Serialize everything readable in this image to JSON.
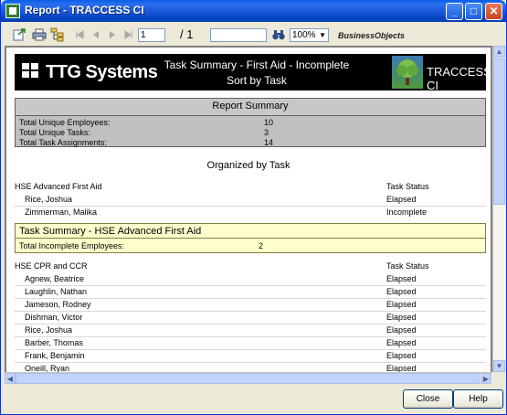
{
  "window": {
    "title": "Report - TRACCESS CI",
    "min_label": "_",
    "max_label": "□",
    "close_label": "✕"
  },
  "toolbar": {
    "page_value": "1",
    "page_total": "/ 1",
    "search_value": "",
    "zoom": "100%",
    "brand": "BusinessObjects"
  },
  "banner": {
    "logo": "TTG Systems",
    "title_line1": "Task Summary - First Aid - Incomplete",
    "title_line2": "Sort by Task",
    "product": "TRACCESS CI"
  },
  "summary": {
    "header": "Report Summary",
    "rows": [
      {
        "label": "Total Unique Employees:",
        "value": "10"
      },
      {
        "label": "Total Unique Tasks:",
        "value": "3"
      },
      {
        "label": "Total Task Assignments:",
        "value": "14"
      }
    ]
  },
  "organized_by": "Organized by Task",
  "group1": {
    "task": "HSE  Advanced First Aid",
    "status_header": "Task Status",
    "rows": [
      {
        "name": "Rice, Joshua",
        "status": "Elapsed"
      },
      {
        "name": "Zimmerman, Malika",
        "status": "Incomplete"
      }
    ],
    "box_title": "Task Summary - HSE  Advanced First Aid",
    "box_label": "Total Incomplete Employees:",
    "box_value": "2"
  },
  "group2": {
    "task": "HSE  CPR and CCR",
    "status_header": "Task Status",
    "rows": [
      {
        "name": "Agnew, Beatrice",
        "status": "Elapsed"
      },
      {
        "name": "Laughlin, Nathan",
        "status": "Elapsed"
      },
      {
        "name": "Jameson, Rodney",
        "status": "Elapsed"
      },
      {
        "name": "Dishman, Victor",
        "status": "Elapsed"
      },
      {
        "name": "Rice, Joshua",
        "status": "Elapsed"
      },
      {
        "name": "Barber, Thomas",
        "status": "Elapsed"
      },
      {
        "name": "Frank, Benjamin",
        "status": "Elapsed"
      },
      {
        "name": "Oneill, Ryan",
        "status": "Elapsed"
      }
    ]
  },
  "footer": {
    "close_label": "Close",
    "help_label": "Help"
  },
  "colors": {
    "titlebar": "#0a5fe6",
    "summary_bg": "#c0c0c0",
    "highlight_box": "#ffffcc"
  },
  "icons": [
    "export-icon",
    "print-icon",
    "group-tree-icon",
    "first-page-icon",
    "prev-page-icon",
    "next-page-icon",
    "last-page-icon",
    "binoculars-icon"
  ]
}
